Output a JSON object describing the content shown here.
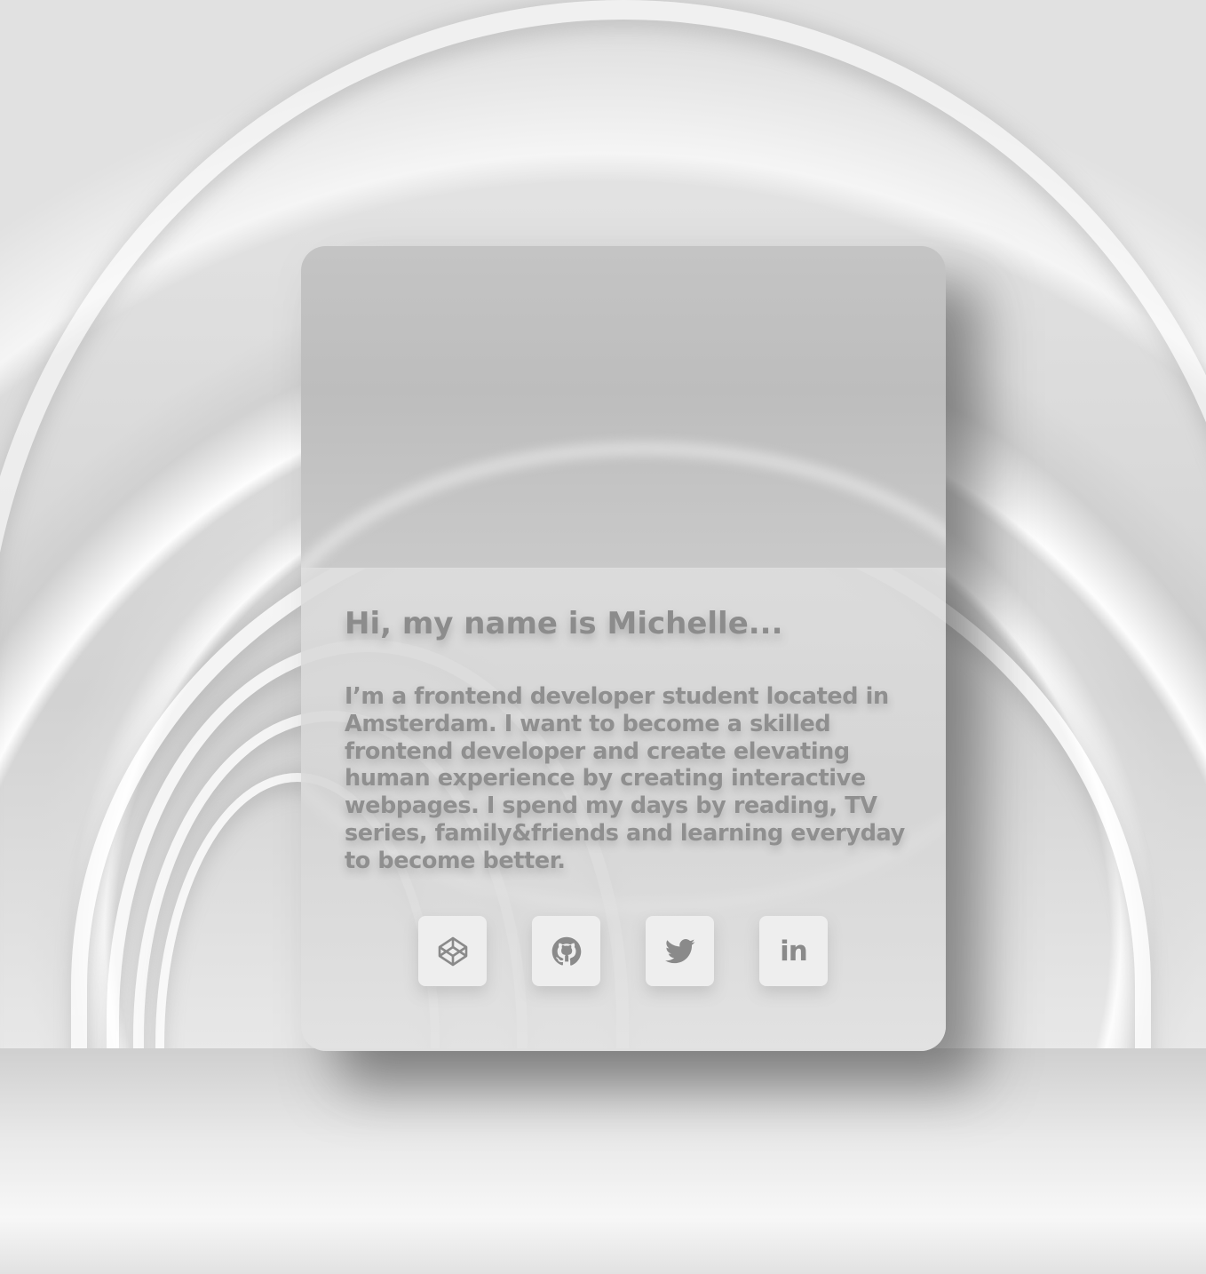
{
  "profile": {
    "heading": "Hi, my name is Michelle...",
    "bio": "I’m a frontend developer student located in Amsterdam. I want to become a skilled frontend developer and create elevating human experience by creating interactive webpages. I spend my days by reading, TV series, family&friends and learning everyday to become better."
  },
  "socials": [
    {
      "icon": "codepen-icon"
    },
    {
      "icon": "github-icon"
    },
    {
      "icon": "twitter-icon"
    },
    {
      "icon": "linkedin-icon",
      "glyph": "in"
    }
  ],
  "colors": {
    "text": "#8c8c8c",
    "button_bg": "#eeeeee",
    "card_shadow": "#5a5a5a"
  }
}
